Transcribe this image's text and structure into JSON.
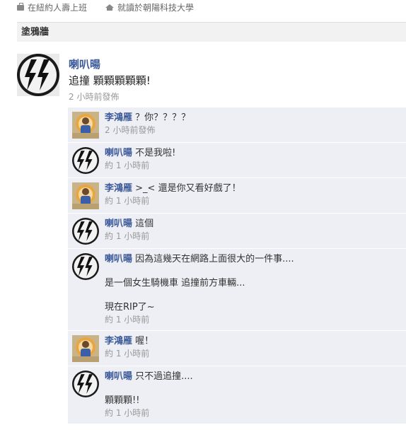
{
  "profile_info": {
    "work_text": "在紐約人壽上班",
    "school_text": "就讀於朝陽科技大學"
  },
  "wall": {
    "title": "塗鴉牆"
  },
  "post": {
    "author": "喇叭暘",
    "text": "追撞 顆顆顆顆顆!",
    "time": "2 小時前發佈"
  },
  "comments": [
    {
      "author": "李鴻雁",
      "avatar": "photo",
      "lines": [
        "？你？？？？"
      ],
      "time": "2 小時前發佈"
    },
    {
      "author": "喇叭暘",
      "avatar": "ss-logo",
      "lines": [
        "不是我啦!"
      ],
      "time": "約 1 小時前"
    },
    {
      "author": "李鴻雁",
      "avatar": "photo",
      "lines": [
        ">_< 還是你又看好戲了！"
      ],
      "time": "約 1 小時前"
    },
    {
      "author": "喇叭暘",
      "avatar": "ss-logo",
      "lines": [
        "這個"
      ],
      "time": "約 1 小時前"
    },
    {
      "author": "喇叭暘",
      "avatar": "ss-logo",
      "lines": [
        "因為這幾天在網路上面很大的一件事....",
        "",
        "是一個女生騎機車 追撞前方車輛...",
        "",
        "現在RIP了~"
      ],
      "time": "約 1 小時前"
    },
    {
      "author": "李鴻雁",
      "avatar": "photo",
      "lines": [
        "喔！"
      ],
      "time": "約 1 小時前"
    },
    {
      "author": "喇叭暘",
      "avatar": "ss-logo",
      "lines": [
        "只不過追撞....",
        "",
        "顆顆顆!!"
      ],
      "time": "約 1 小時前"
    }
  ]
}
